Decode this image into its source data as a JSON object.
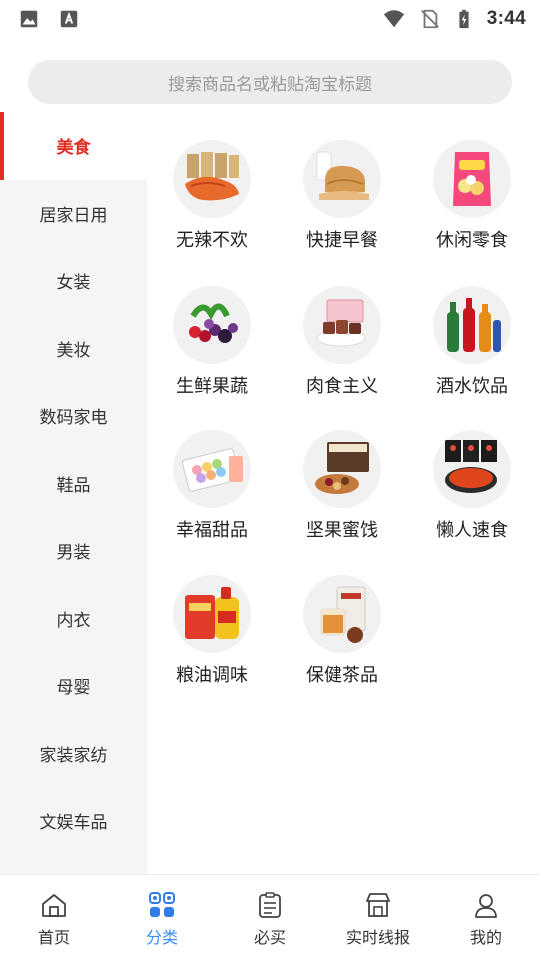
{
  "status_bar": {
    "time": "3:44"
  },
  "search": {
    "placeholder": "搜索商品名或粘贴淘宝标题"
  },
  "sidebar": {
    "items": [
      {
        "label": "美食",
        "active": true
      },
      {
        "label": "居家日用"
      },
      {
        "label": "女装"
      },
      {
        "label": "美妆"
      },
      {
        "label": "数码家电"
      },
      {
        "label": "鞋品"
      },
      {
        "label": "男装"
      },
      {
        "label": "内衣"
      },
      {
        "label": "母婴"
      },
      {
        "label": "家装家纺"
      },
      {
        "label": "文娱车品"
      }
    ]
  },
  "categories": [
    {
      "label": "无辣不欢",
      "icon": "spicy-snack-image"
    },
    {
      "label": "快捷早餐",
      "icon": "bread-breakfast-image"
    },
    {
      "label": "休闲零食",
      "icon": "chips-snack-image"
    },
    {
      "label": "生鲜果蔬",
      "icon": "fresh-fruit-image"
    },
    {
      "label": "肉食主义",
      "icon": "meat-jerky-image"
    },
    {
      "label": "酒水饮品",
      "icon": "drink-bottles-image"
    },
    {
      "label": "幸福甜品",
      "icon": "macaron-dessert-image"
    },
    {
      "label": "坚果蜜饯",
      "icon": "nut-box-image"
    },
    {
      "label": "懒人速食",
      "icon": "instant-noodles-image"
    },
    {
      "label": "粮油调味",
      "icon": "rice-oil-image"
    },
    {
      "label": "保健茶品",
      "icon": "health-tea-image"
    }
  ],
  "bottom_nav": {
    "items": [
      {
        "label": "首页",
        "icon": "home-icon"
      },
      {
        "label": "分类",
        "icon": "category-icon",
        "active": true
      },
      {
        "label": "必买",
        "icon": "clipboard-icon"
      },
      {
        "label": "实时线报",
        "icon": "store-icon"
      },
      {
        "label": "我的",
        "icon": "profile-icon"
      }
    ]
  },
  "colors": {
    "accent_red": "#e02e24",
    "nav_active_blue": "#3a8ef7"
  }
}
